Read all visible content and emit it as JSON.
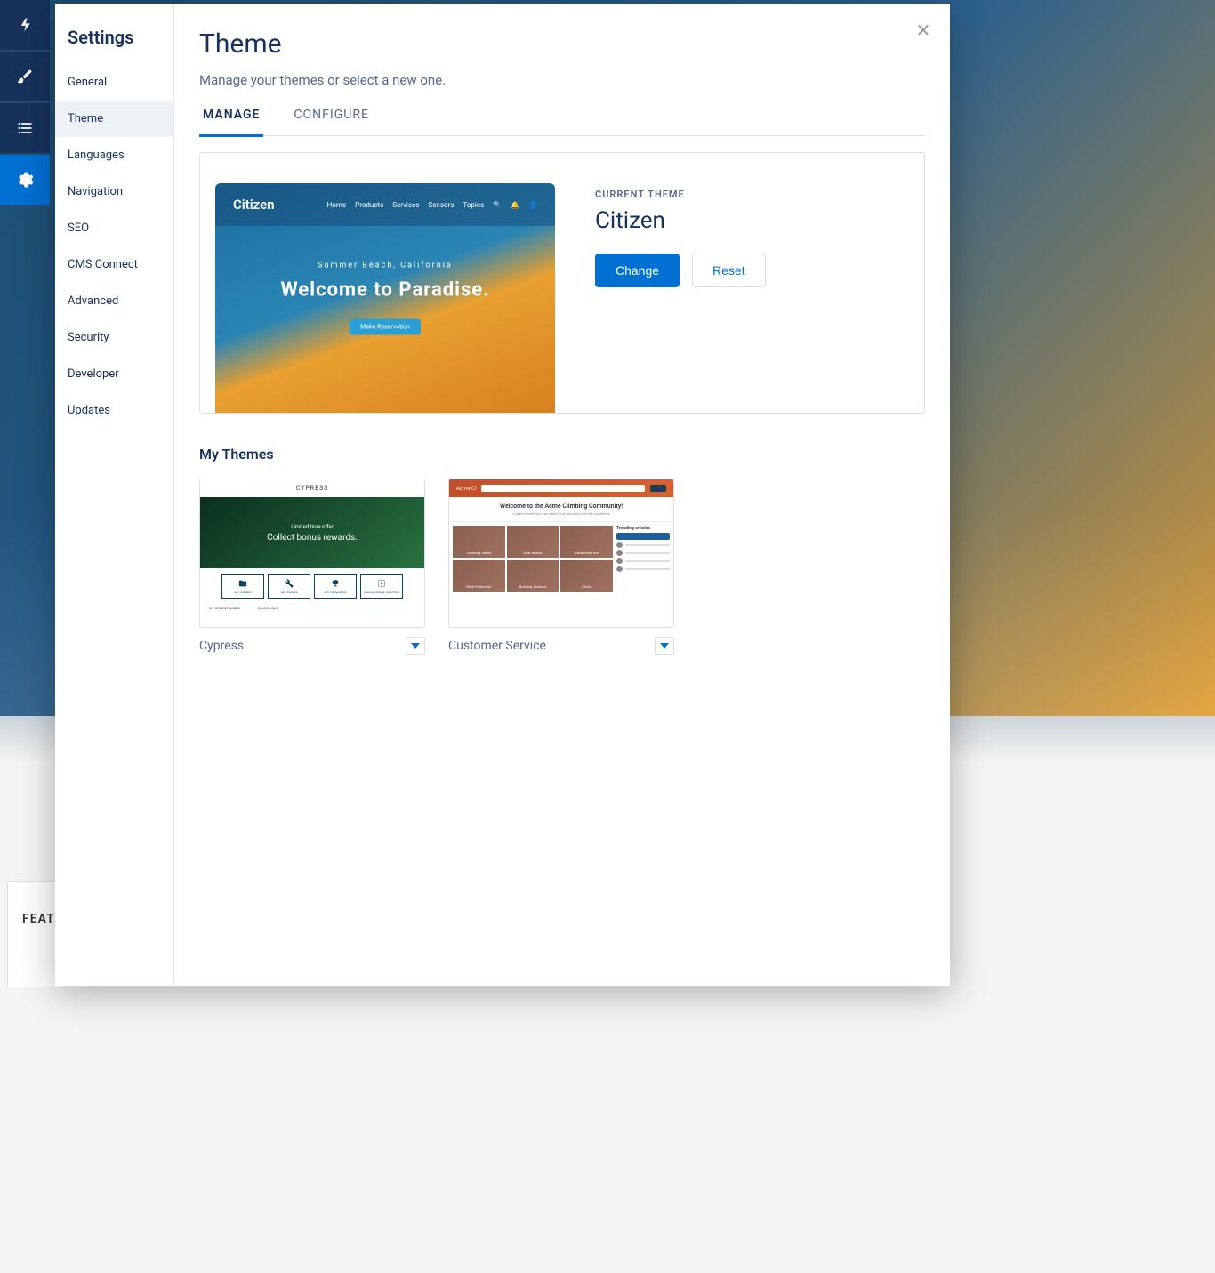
{
  "bg": {
    "feat_tab": "FEAT"
  },
  "rail": [
    {
      "name": "bolt-icon"
    },
    {
      "name": "brush-icon"
    },
    {
      "name": "list-icon"
    },
    {
      "name": "gear-icon",
      "active": true
    }
  ],
  "sidebar": {
    "title": "Settings",
    "items": [
      {
        "label": "General"
      },
      {
        "label": "Theme",
        "active": true
      },
      {
        "label": "Languages"
      },
      {
        "label": "Navigation"
      },
      {
        "label": "SEO"
      },
      {
        "label": "CMS Connect"
      },
      {
        "label": "Advanced"
      },
      {
        "label": "Security"
      },
      {
        "label": "Developer"
      },
      {
        "label": "Updates"
      }
    ]
  },
  "main": {
    "title": "Theme",
    "subtitle": "Manage your themes or select a new one.",
    "tabs": [
      {
        "label": "MANAGE",
        "active": true
      },
      {
        "label": "CONFIGURE"
      }
    ],
    "current": {
      "label": "CURRENT THEME",
      "name": "Citizen",
      "change_btn": "Change",
      "reset_btn": "Reset",
      "preview": {
        "logo": "Citizen",
        "nav": [
          "Home",
          "Products",
          "Services",
          "Sensors",
          "Topics"
        ],
        "location": "Summer Beach, California",
        "headline": "Welcome to Paradise.",
        "cta": "Make Reservation"
      }
    },
    "my_themes_title": "My Themes",
    "themes": [
      {
        "name": "Cypress",
        "preview": {
          "brand": "CYPRESS",
          "hero_sub": "Limited time offer",
          "hero_main": "Collect bonus rewards.",
          "tiles": [
            "MY CASES",
            "MY TASKS",
            "MY REWARDS",
            "KNOWLEDGE CENTER"
          ],
          "bottom_cols": [
            "MY RECENT CASES",
            "QUICK LINKS"
          ]
        }
      },
      {
        "name": "Customer Service",
        "preview": {
          "brand": "Acme Cl",
          "welcome": "Welcome to the Acme Climbing Community!",
          "sub": "A place where you can easily find solutions and ask questions",
          "gallery": [
            "Climbing Safety",
            "Gear Basics",
            "Advanced Tech",
            "Rack Protection",
            "Building Anchors",
            "Knots"
          ],
          "side_hdr": "Trending articles"
        }
      }
    ]
  }
}
